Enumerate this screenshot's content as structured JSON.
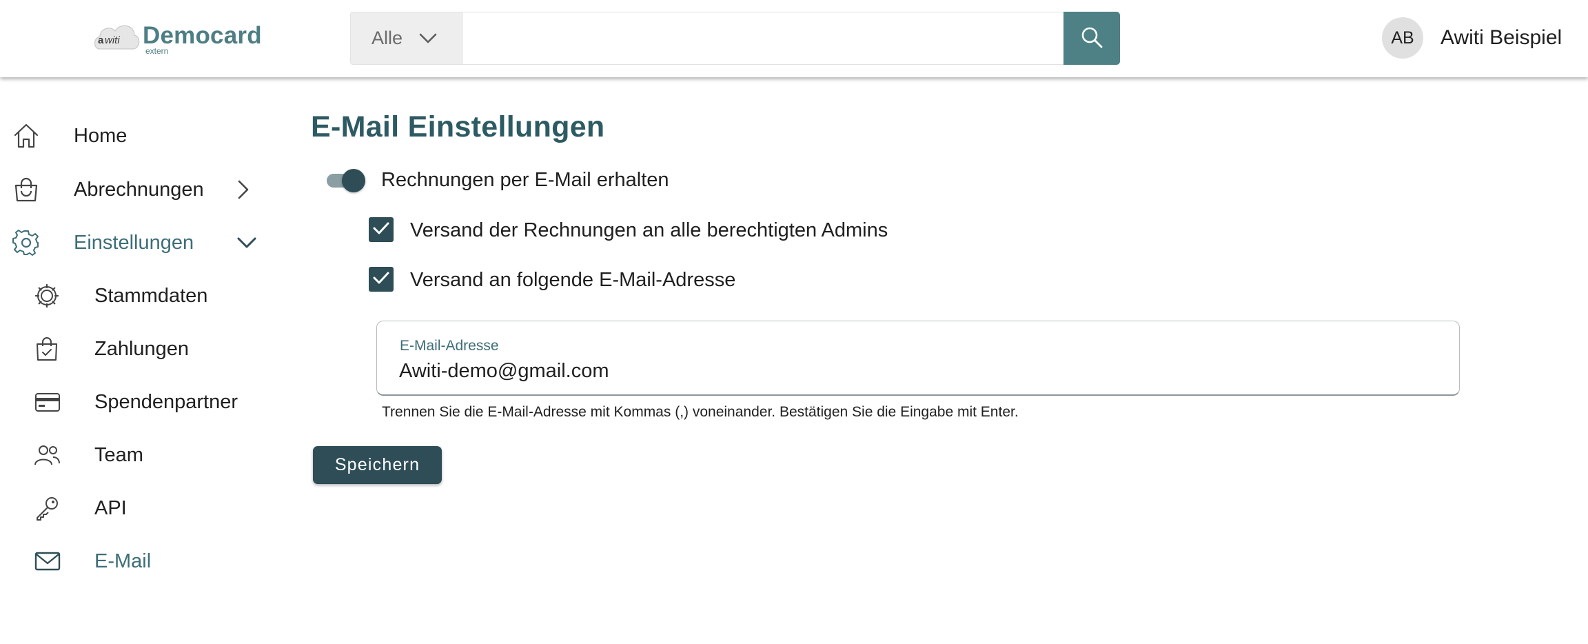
{
  "header": {
    "logo": {
      "brand_name": "Democard",
      "brand_sub": "extern",
      "logo_mark_text": "awiti"
    },
    "search": {
      "scope_label": "Alle",
      "value": "",
      "placeholder": ""
    },
    "user": {
      "initials": "AB",
      "name": "Awiti Beispiel"
    }
  },
  "sidebar": {
    "items": [
      {
        "label": "Home",
        "icon": "home-icon"
      },
      {
        "label": "Abrechnungen",
        "icon": "shopping-bag-icon",
        "expander": "chevron-right-icon"
      },
      {
        "label": "Einstellungen",
        "icon": "gear-icon",
        "expander": "chevron-down-icon",
        "active": true
      },
      {
        "label": "Stammdaten",
        "icon": "cog-outline-icon"
      },
      {
        "label": "Zahlungen",
        "icon": "bag-check-icon"
      },
      {
        "label": "Spendenpartner",
        "icon": "credit-card-icon"
      },
      {
        "label": "Team",
        "icon": "people-icon"
      },
      {
        "label": "API",
        "icon": "key-icon"
      },
      {
        "label": "E-Mail",
        "icon": "mail-icon",
        "active": true
      }
    ]
  },
  "main": {
    "title": "E-Mail Einstellungen",
    "toggle": {
      "label": "Rechnungen per E-Mail erhalten",
      "on": true
    },
    "checkboxes": [
      {
        "label": "Versand der Rechnungen an alle berechtigten Admins",
        "checked": true
      },
      {
        "label": "Versand an folgende E-Mail-Adresse",
        "checked": true
      }
    ],
    "email_field": {
      "label": "E-Mail-Adresse",
      "value": "Awiti-demo@gmail.com"
    },
    "hint": "Trennen Sie die E-Mail-Adresse mit Kommas (,) voneinander. Bestätigen Sie die Eingabe mit Enter.",
    "save_label": "Speichern"
  },
  "colors": {
    "brand_teal": "#4d7e83",
    "search_button": "#4d8186",
    "primary_dark": "#2e4d57",
    "title_color": "#2d5a63",
    "active_nav": "#3d6e78"
  }
}
